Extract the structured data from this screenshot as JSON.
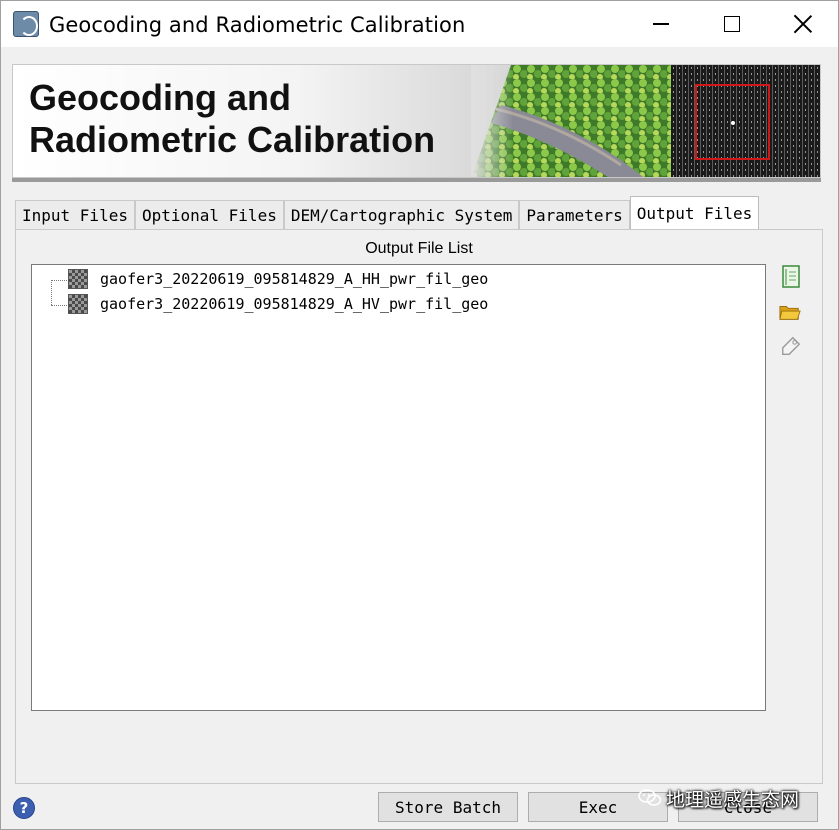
{
  "window": {
    "title": "Geocoding and Radiometric Calibration",
    "controls": {
      "minimize_icon": "minimize-icon",
      "maximize_icon": "maximize-icon",
      "close_icon": "close-icon"
    }
  },
  "banner": {
    "heading": "Geocoding and Radiometric Calibration"
  },
  "tabs": [
    {
      "label": "Input Files",
      "active": false
    },
    {
      "label": "Optional Files",
      "active": false
    },
    {
      "label": "DEM/Cartographic System",
      "active": false
    },
    {
      "label": "Parameters",
      "active": false
    },
    {
      "label": "Output Files",
      "active": true
    }
  ],
  "output_panel": {
    "list_label": "Output File List",
    "files": [
      {
        "name": "gaofer3_20220619_095814829_A_HH_pwr_fil_geo",
        "icon": "raster-file-icon"
      },
      {
        "name": "gaofer3_20220619_095814829_A_HV_pwr_fil_geo",
        "icon": "raster-file-icon"
      }
    ],
    "side_tools": [
      "new-file-icon",
      "open-folder-icon",
      "tag-icon"
    ]
  },
  "footer": {
    "help_icon": "help-icon",
    "help_glyph": "?",
    "buttons": {
      "store_batch": "Store Batch",
      "exec": "Exec",
      "close": "Close"
    },
    "watermark": "地理遥感生态网"
  },
  "colors": {
    "window_bg": "#f0f0f0",
    "titlebar_bg": "#ffffff",
    "list_bg": "#ffffff",
    "help_blue": "#3d5fb0",
    "banner_red_box": "#d01818"
  }
}
